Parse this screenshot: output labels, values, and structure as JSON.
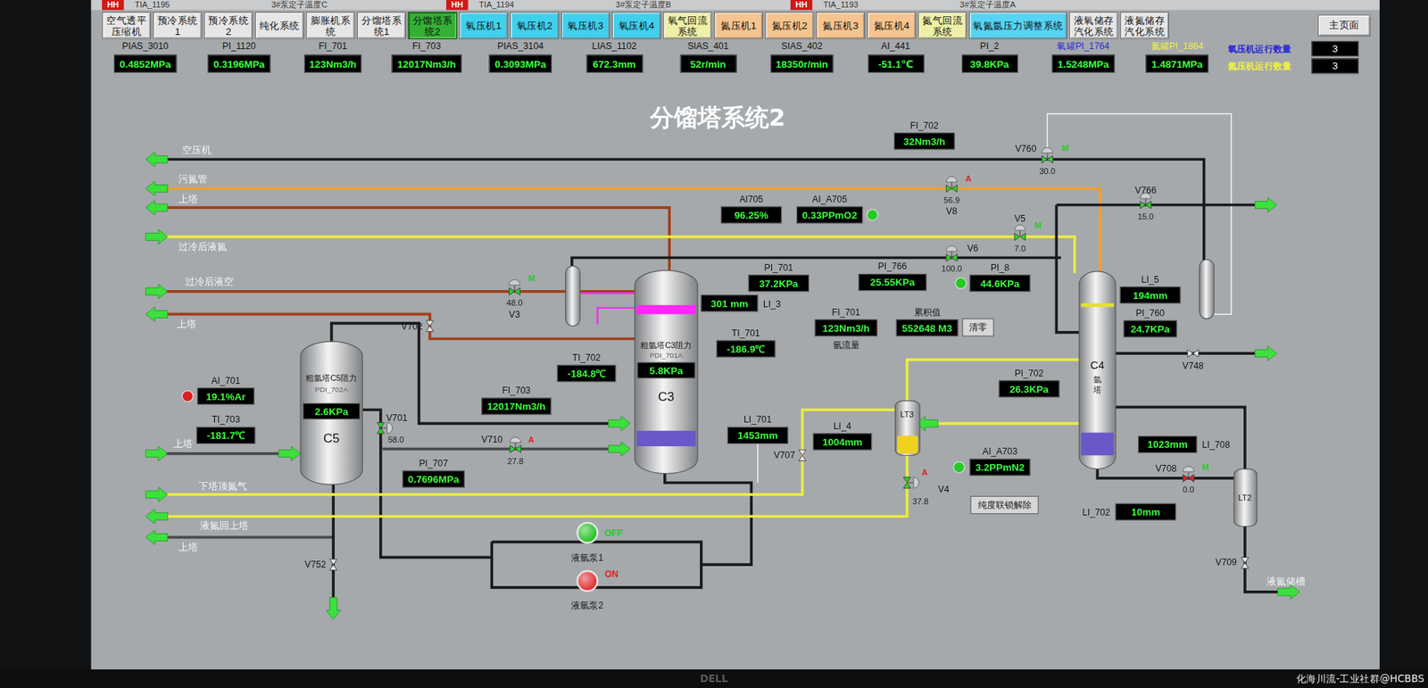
{
  "alarms": [
    {
      "badge": "HH",
      "tag": "TIA_1195",
      "text": "3#泵定子温度C"
    },
    {
      "badge": "HH",
      "tag": "TIA_1194",
      "text": "3#泵定子温度B"
    },
    {
      "badge": "HH",
      "tag": "TIA_1193",
      "text": "3#泵定子温度A"
    }
  ],
  "tabs": [
    {
      "label": "空气透平压缩机",
      "selected": false,
      "color": "#e6e6e6"
    },
    {
      "label": "预冷系统1",
      "selected": false,
      "color": "#e6e6e6"
    },
    {
      "label": "预冷系统2",
      "selected": false,
      "color": "#e6e6e6"
    },
    {
      "label": "纯化系统",
      "selected": false,
      "color": "#e6e6e6"
    },
    {
      "label": "膨胀机系统",
      "selected": false,
      "color": "#e6e6e6"
    },
    {
      "label": "分馏塔系统1",
      "selected": false,
      "color": "#e6e6e6"
    },
    {
      "label": "分馏塔系统2",
      "selected": true,
      "color": "#35b035"
    },
    {
      "label": "氧压机1",
      "selected": false,
      "color": "#3fd0ee"
    },
    {
      "label": "氧压机2",
      "selected": false,
      "color": "#3fd0ee"
    },
    {
      "label": "氧压机3",
      "selected": false,
      "color": "#3fd0ee"
    },
    {
      "label": "氧压机4",
      "selected": false,
      "color": "#3fd0ee"
    },
    {
      "label": "氧气回流系统",
      "selected": false,
      "color": "#eef0a8"
    },
    {
      "label": "氮压机1",
      "selected": false,
      "color": "#f6c48e"
    },
    {
      "label": "氮压机2",
      "selected": false,
      "color": "#f6c48e"
    },
    {
      "label": "氮压机3",
      "selected": false,
      "color": "#f6c48e"
    },
    {
      "label": "氮压机4",
      "selected": false,
      "color": "#f6c48e"
    },
    {
      "label": "氮气回流系统",
      "selected": false,
      "color": "#eef0a8"
    },
    {
      "label": "氧氮氩压力调整系统",
      "selected": false,
      "color": "#55d4f4"
    },
    {
      "label": "液氧储存汽化系统",
      "selected": false,
      "color": "#e6e6e6"
    },
    {
      "label": "液氮储存汽化系统",
      "selected": false,
      "color": "#e6e6e6"
    }
  ],
  "home_button": "主页面",
  "readings": [
    {
      "label": "PIAS_3010",
      "value": "0.4852MPa",
      "color": "#111111"
    },
    {
      "label": "PI_1120",
      "value": "0.3196MPa",
      "color": "#111111"
    },
    {
      "label": "FI_701",
      "value": "123Nm3/h",
      "color": "#111111"
    },
    {
      "label": "FI_703",
      "value": "12017Nm3/h",
      "color": "#111111"
    },
    {
      "label": "PIAS_3104",
      "value": "0.3093MPa",
      "color": "#111111"
    },
    {
      "label": "LIAS_1102",
      "value": "672.3mm",
      "color": "#111111"
    },
    {
      "label": "SIAS_401",
      "value": "52r/min",
      "color": "#111111"
    },
    {
      "label": "SIAS_402",
      "value": "18350r/min",
      "color": "#111111"
    },
    {
      "label": "AI_441",
      "value": "-51.1℃",
      "color": "#111111"
    },
    {
      "label": "PI_2",
      "value": "39.8KPa",
      "color": "#111111"
    },
    {
      "label": "氧罐PI_1764",
      "value": "1.5248MPa",
      "color": "#2a2ad0"
    },
    {
      "label": "氮罐PI_1864",
      "value": "1.4871MPa",
      "color": "#f0f040"
    }
  ],
  "counters": [
    {
      "label": "氧压机运行数量",
      "value": "3",
      "color": "#2a2ad0"
    },
    {
      "label": "氮压机运行数量",
      "value": "3",
      "color": "#f0f040"
    }
  ],
  "title": "分馏塔系统2",
  "streams": [
    {
      "label": "空压机",
      "kind": "out"
    },
    {
      "label": "污氮管",
      "kind": "out"
    },
    {
      "label": "上塔",
      "kind": "out"
    },
    {
      "label": "过冷后液氮",
      "kind": "in"
    },
    {
      "label": "过冷后液空",
      "kind": "in"
    },
    {
      "label": "上塔",
      "kind": "out"
    },
    {
      "label": "上塔",
      "kind": "in"
    },
    {
      "label": "下塔顶氮气",
      "kind": "in"
    },
    {
      "label": "液氮回上塔",
      "kind": "out"
    },
    {
      "label": "上塔",
      "kind": "out"
    }
  ],
  "outlet_label": "液氮储槽",
  "vessels": [
    {
      "name": "C5",
      "caption": "粗氩塔C5阻力",
      "tag": "PDI_702A",
      "value": "2.6KPa"
    },
    {
      "name": "C3",
      "caption": "粗氩塔C3阻力",
      "tag": "PDI_701A",
      "value": "5.8KPa"
    }
  ],
  "column_c4": {
    "name": "C4",
    "caption": "氩塔"
  },
  "level_tanks": [
    {
      "name": "LT3",
      "level": 0.35
    },
    {
      "name": "LT2",
      "level": 0
    }
  ],
  "gauges": [
    {
      "tag": "AI705",
      "value": "96.25%"
    },
    {
      "tag": "AI_A705",
      "value": "0.33PPmO2",
      "lamp": "#22cc22"
    },
    {
      "tag": "FI_702",
      "value": "32Nm3/h"
    },
    {
      "tag": "PI_701",
      "value": "37.2KPa"
    },
    {
      "tag": "LI_3",
      "value": "301 mm"
    },
    {
      "tag": "TI_701",
      "value": "-186.9℃"
    },
    {
      "tag": "TI_702",
      "value": "-184.8℃"
    },
    {
      "tag": "PI_766",
      "value": "25.55KPa"
    },
    {
      "tag": "PI_8",
      "value": "44.6KPa",
      "lamp": "#22cc22"
    },
    {
      "tag": "FI_701",
      "value": "123Nm3/h",
      "caption": "氩流量"
    },
    {
      "tag": "累积值",
      "value": "552648 M3"
    },
    {
      "tag": "LI_5",
      "value": "194mm"
    },
    {
      "tag": "PI_760",
      "value": "24.7KPa"
    },
    {
      "tag": "PI_702",
      "value": "26.3KPa"
    },
    {
      "tag": "AI_701",
      "value": "19.1%Ar",
      "lamp": "#e02020"
    },
    {
      "tag": "TI_703",
      "value": "-181.7℃"
    },
    {
      "tag": "FI_703",
      "value": "12017Nm3/h"
    },
    {
      "tag": "LI_701",
      "value": "1453mm"
    },
    {
      "tag": "PI_707",
      "value": "0.7696MPa"
    },
    {
      "tag": "LI_4",
      "value": "1004mm"
    },
    {
      "tag": "AI_A703",
      "value": "3.2PPmN2",
      "lamp": "#22cc22"
    },
    {
      "tag": "LI_708",
      "value": "1023mm"
    },
    {
      "tag": "LI_702",
      "value": "10mm"
    }
  ],
  "valves": [
    {
      "tag": "V760",
      "kind": "control",
      "mode": "M",
      "mode_color": "#22cc22",
      "position": "30.0",
      "open": true
    },
    {
      "tag": "V8",
      "kind": "control",
      "mode": "A",
      "mode_color": "#e02020",
      "position": "56.9",
      "open": true
    },
    {
      "tag": "V766",
      "kind": "control",
      "mode": "",
      "mode_color": "",
      "position": "15.0",
      "open": true
    },
    {
      "tag": "V5",
      "kind": "control",
      "mode": "M",
      "mode_color": "#22cc22",
      "position": "7.0",
      "open": true
    },
    {
      "tag": "V6",
      "kind": "control",
      "mode": "",
      "mode_color": "",
      "position": "100.0",
      "open": true
    },
    {
      "tag": "V3",
      "kind": "control",
      "mode": "M",
      "mode_color": "#22cc22",
      "position": "48.0",
      "open": true
    },
    {
      "tag": "V702",
      "kind": "manual",
      "mode": "",
      "mode_color": "",
      "position": "",
      "open": true
    },
    {
      "tag": "V701",
      "kind": "control",
      "mode": "",
      "mode_color": "",
      "position": "58.0",
      "open": true
    },
    {
      "tag": "V710",
      "kind": "control",
      "mode": "A",
      "mode_color": "#e02020",
      "position": "27.8",
      "open": true
    },
    {
      "tag": "V707",
      "kind": "manual",
      "mode": "",
      "mode_color": "",
      "position": "",
      "open": true
    },
    {
      "tag": "V4",
      "kind": "control",
      "mode": "A",
      "mode_color": "#e02020",
      "position": "37.8",
      "open": true
    },
    {
      "tag": "V708",
      "kind": "control",
      "mode": "M",
      "mode_color": "#22cc22",
      "position": "0.0",
      "open": false
    },
    {
      "tag": "V748",
      "kind": "manual",
      "mode": "",
      "mode_color": "",
      "position": "",
      "open": true
    },
    {
      "tag": "V709",
      "kind": "manual",
      "mode": "",
      "mode_color": "",
      "position": "",
      "open": true
    },
    {
      "tag": "V752",
      "kind": "manual",
      "mode": "",
      "mode_color": "",
      "position": "",
      "open": true
    }
  ],
  "pumps": [
    {
      "name": "液氩泵1",
      "status": "OFF",
      "running": false
    },
    {
      "name": "液氩泵2",
      "status": "ON",
      "running": true
    }
  ],
  "buttons": [
    "清零",
    "纯度联锁解除"
  ],
  "bezel_logo": "DELL",
  "watermark": "化海川流-工业社群@HCBBS"
}
